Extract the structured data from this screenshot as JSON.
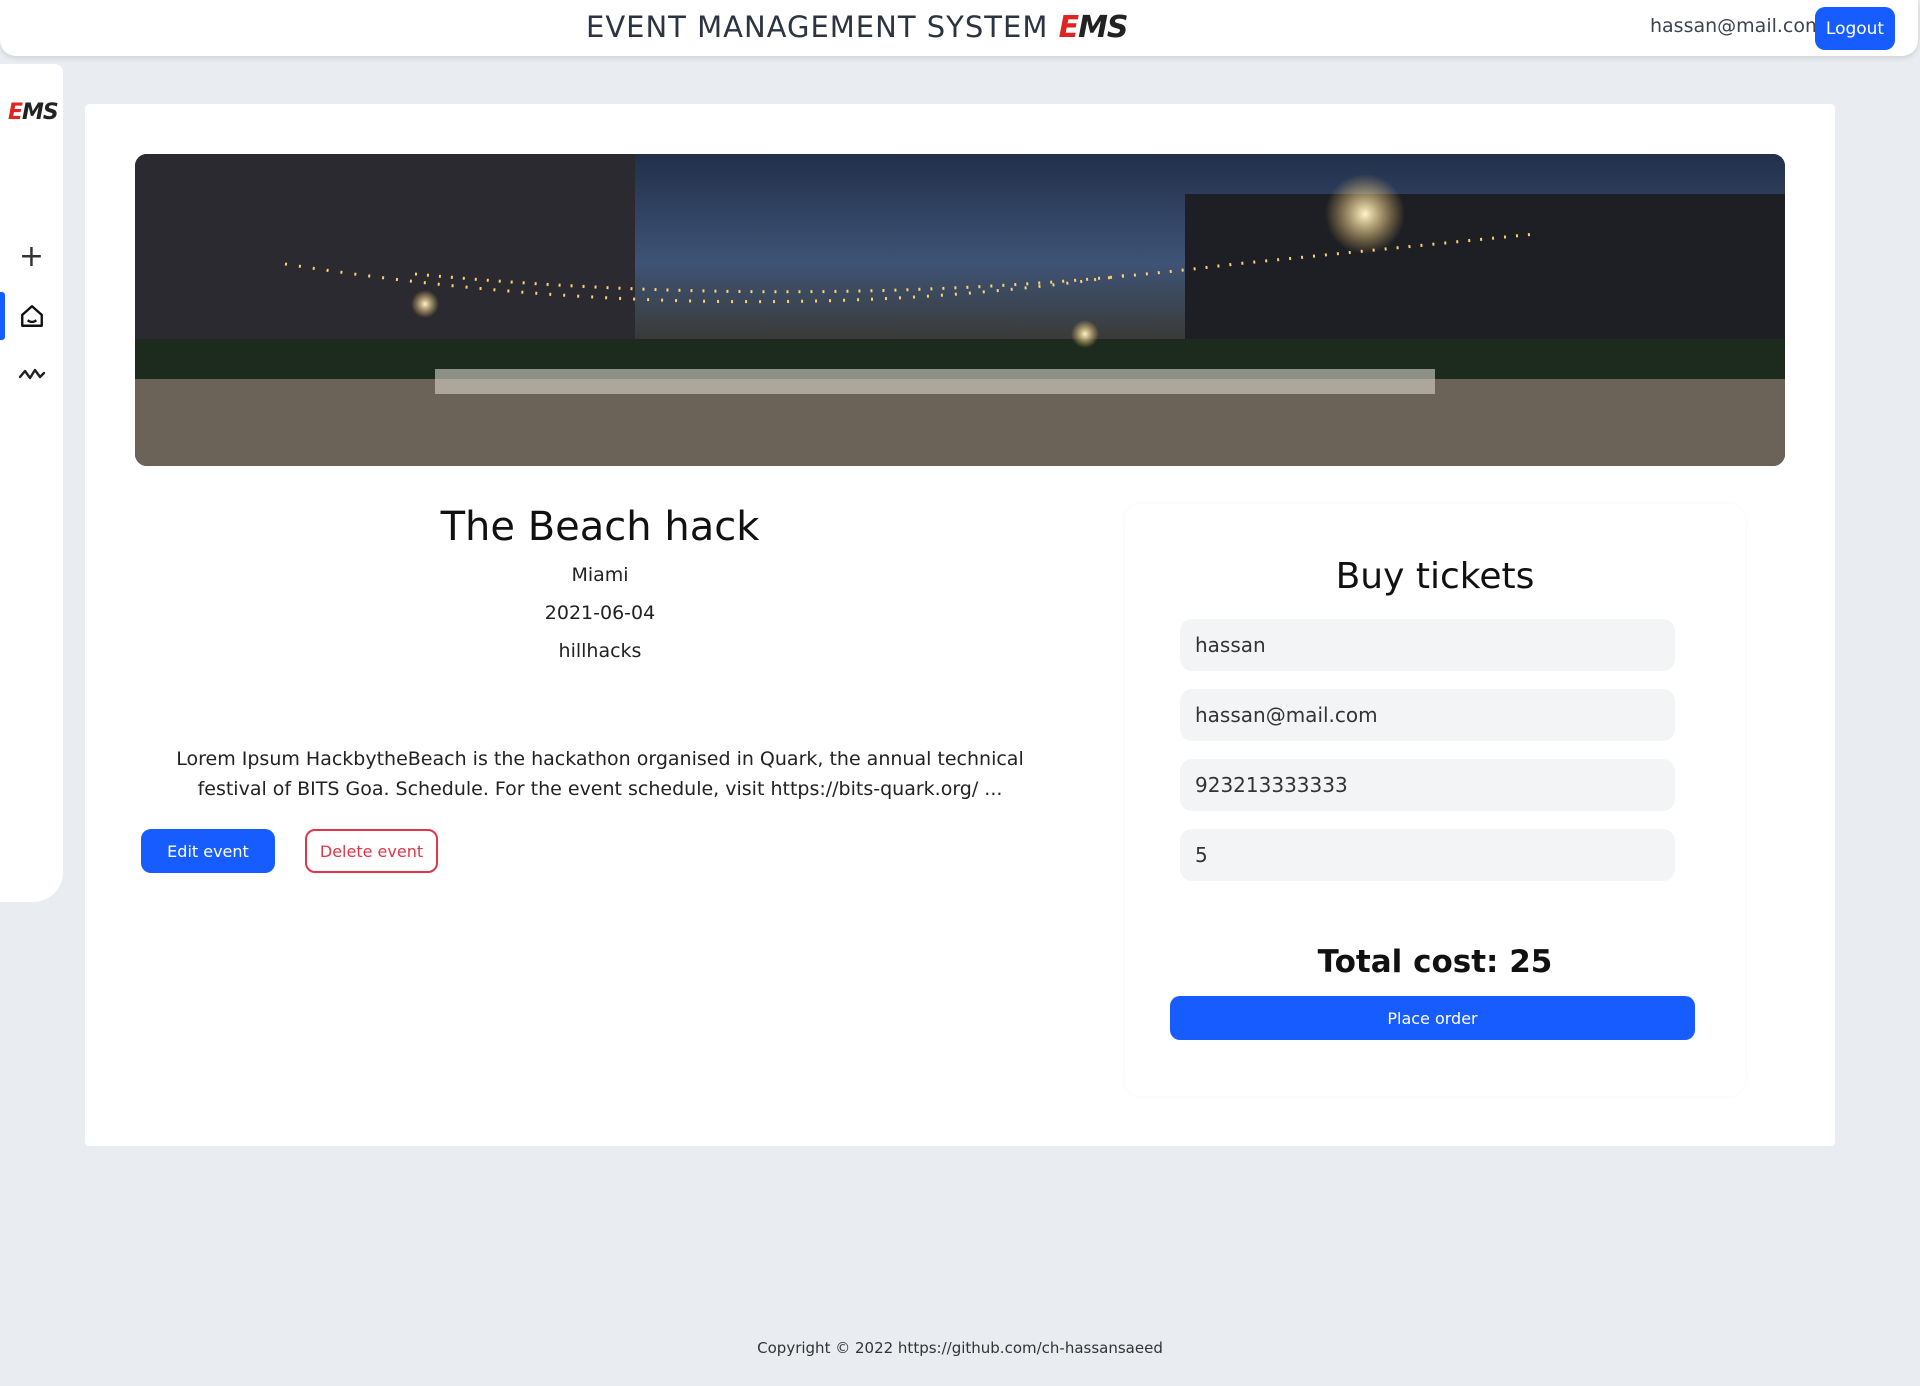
{
  "header": {
    "title": "EVENT MANAGEMENT SYSTEM",
    "logo_e": "E",
    "logo_ms": "MS",
    "user_email": "hassan@mail.com",
    "logout_label": "Logout"
  },
  "sidebar": {
    "logo_e": "E",
    "logo_ms": "MS",
    "items": [
      {
        "icon": "plus-icon",
        "label": "+"
      },
      {
        "icon": "home-icon",
        "active": true
      },
      {
        "icon": "activity-icon"
      }
    ]
  },
  "event": {
    "title": "The Beach hack",
    "location": "Miami",
    "date": "2021-06-04",
    "organizer": "hillhacks",
    "description": "Lorem Ipsum HackbytheBeach is the hackathon organised in Quark, the annual technical festival of BITS Goa. Schedule. For the event schedule, visit https://bits-quark.org/ ...",
    "edit_label": "Edit event",
    "delete_label": "Delete event"
  },
  "order": {
    "title": "Buy tickets",
    "name_value": "hassan",
    "email_value": "hassan@mail.com",
    "phone_value": "923213333333",
    "quantity_value": "5",
    "total_label": "Total cost: 25",
    "place_order_label": "Place order"
  },
  "footer": {
    "copyright": "Copyright © 2022 https://github.com/ch-hassansaeed"
  },
  "colors": {
    "accent": "#175cff",
    "danger": "#e0364a",
    "background": "#e9ecf0",
    "logo_red": "#e0241f"
  }
}
